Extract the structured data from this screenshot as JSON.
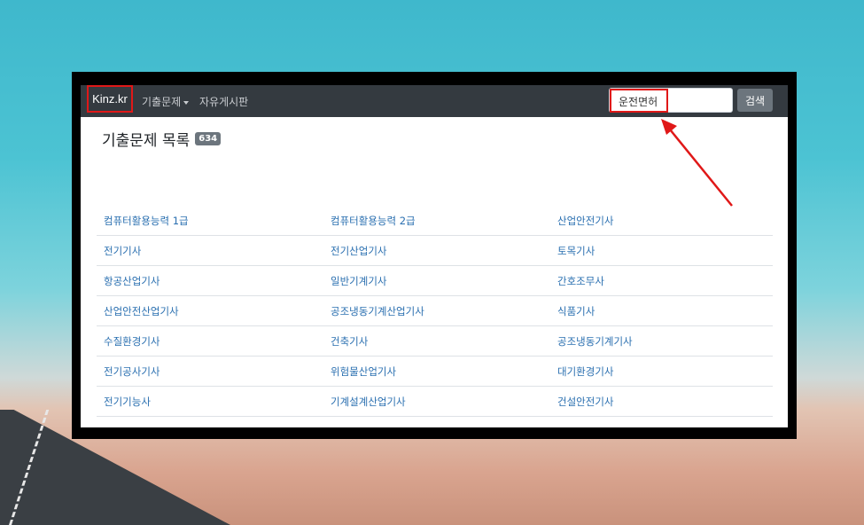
{
  "navbar": {
    "brand": "Kinz.kr",
    "menu_questions": "기출문제",
    "menu_board": "자유게시판",
    "search_value": "운전면허",
    "search_button": "검색"
  },
  "main": {
    "heading": "기출문제 목록",
    "count_badge": "634"
  },
  "list": [
    [
      "컴퓨터활용능력 1급",
      "컴퓨터활용능력 2급",
      "산업안전기사"
    ],
    [
      "전기기사",
      "전기산업기사",
      "토목기사"
    ],
    [
      "항공산업기사",
      "일반기계기사",
      "간호조무사"
    ],
    [
      "산업안전산업기사",
      "공조냉동기계산업기사",
      "식품기사"
    ],
    [
      "수질환경기사",
      "건축기사",
      "공조냉동기계기사"
    ],
    [
      "전기공사기사",
      "위험물산업기사",
      "대기환경기사"
    ],
    [
      "전기기능사",
      "기계설계산업기사",
      "건설안전기사"
    ]
  ],
  "colors": {
    "navbar_bg": "#343a40",
    "link": "#2a6fb0",
    "highlight": "#e01818",
    "badge_bg": "#6c757d"
  }
}
